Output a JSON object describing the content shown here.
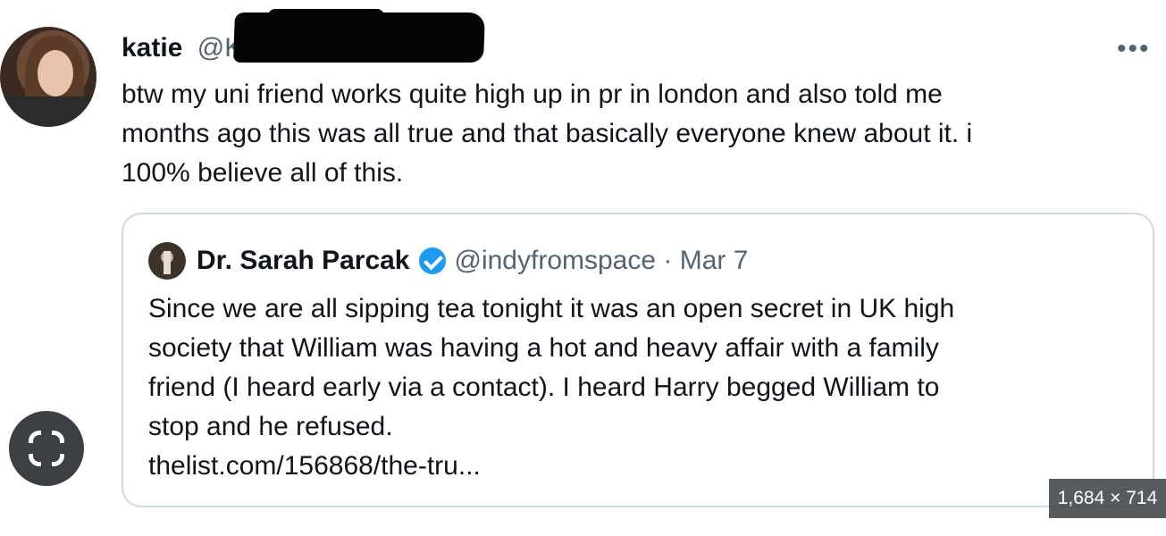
{
  "tweet": {
    "author_name": "katie",
    "author_handle": "@Ka",
    "more_icon": "ellipsis-icon",
    "text_lines": [
      "btw my uni friend works quite high up in pr in london and also told me",
      "months ago this was all true and that basically everyone knew about it. i",
      "100% believe all of this."
    ]
  },
  "quoted": {
    "author_name": "Dr. Sarah Parcak",
    "verified_icon": "verified-badge-icon",
    "meta": "@indyfromspace · Mar 7",
    "text_lines": [
      "Since we are all sipping tea tonight it was an open secret in UK high",
      "society that William was having a hot and heavy affair with a family",
      "friend (I heard early via a contact). I heard Harry begged William to",
      "stop and he refused.",
      "thelist.com/156868/the-tru..."
    ]
  },
  "overlay": {
    "lens_icon": "google-lens-icon",
    "dimensions": "1,684 × 714"
  },
  "colors": {
    "text": "#0f1419",
    "secondary": "#536471",
    "border": "#cfd9de",
    "verified": "#1d9bf0"
  }
}
